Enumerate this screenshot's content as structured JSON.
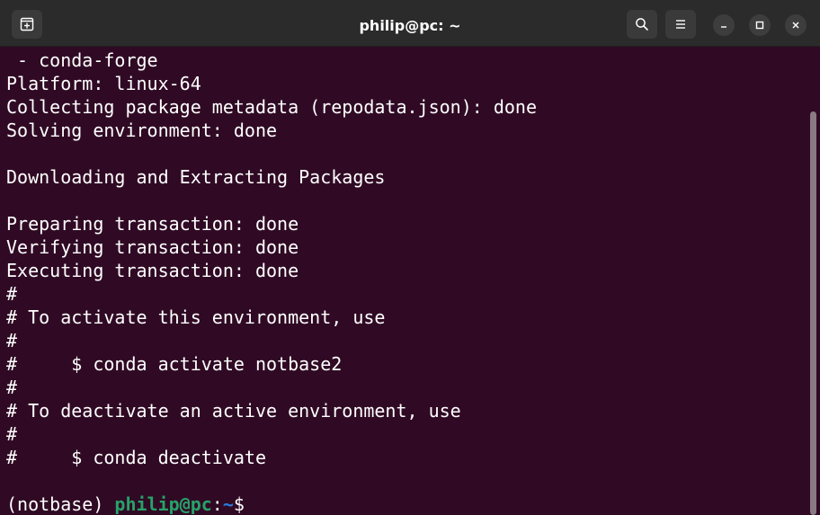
{
  "window": {
    "title": "philip@pc: ~"
  },
  "icons": {
    "new_tab": "new-tab-icon",
    "search": "search-icon",
    "menu": "hamburger-menu-icon",
    "minimize": "minimize-icon",
    "maximize": "maximize-icon",
    "close": "close-icon"
  },
  "colors": {
    "background": "#300a24",
    "titlebar": "#2b2b2b",
    "text": "#ffffff",
    "prompt_user": "#26a269",
    "prompt_path": "#2a7bde"
  },
  "terminal": {
    "lines": [
      " - conda-forge",
      "Platform: linux-64",
      "Collecting package metadata (repodata.json): done",
      "Solving environment: done",
      "",
      "Downloading and Extracting Packages",
      "",
      "Preparing transaction: done",
      "Verifying transaction: done",
      "Executing transaction: done",
      "#",
      "# To activate this environment, use",
      "#",
      "#     $ conda activate notbase2",
      "#",
      "# To deactivate an active environment, use",
      "#",
      "#     $ conda deactivate",
      ""
    ],
    "prompt": {
      "env": "(notbase) ",
      "user_host": "philip@pc",
      "colon": ":",
      "path": "~",
      "symbol": "$"
    }
  }
}
